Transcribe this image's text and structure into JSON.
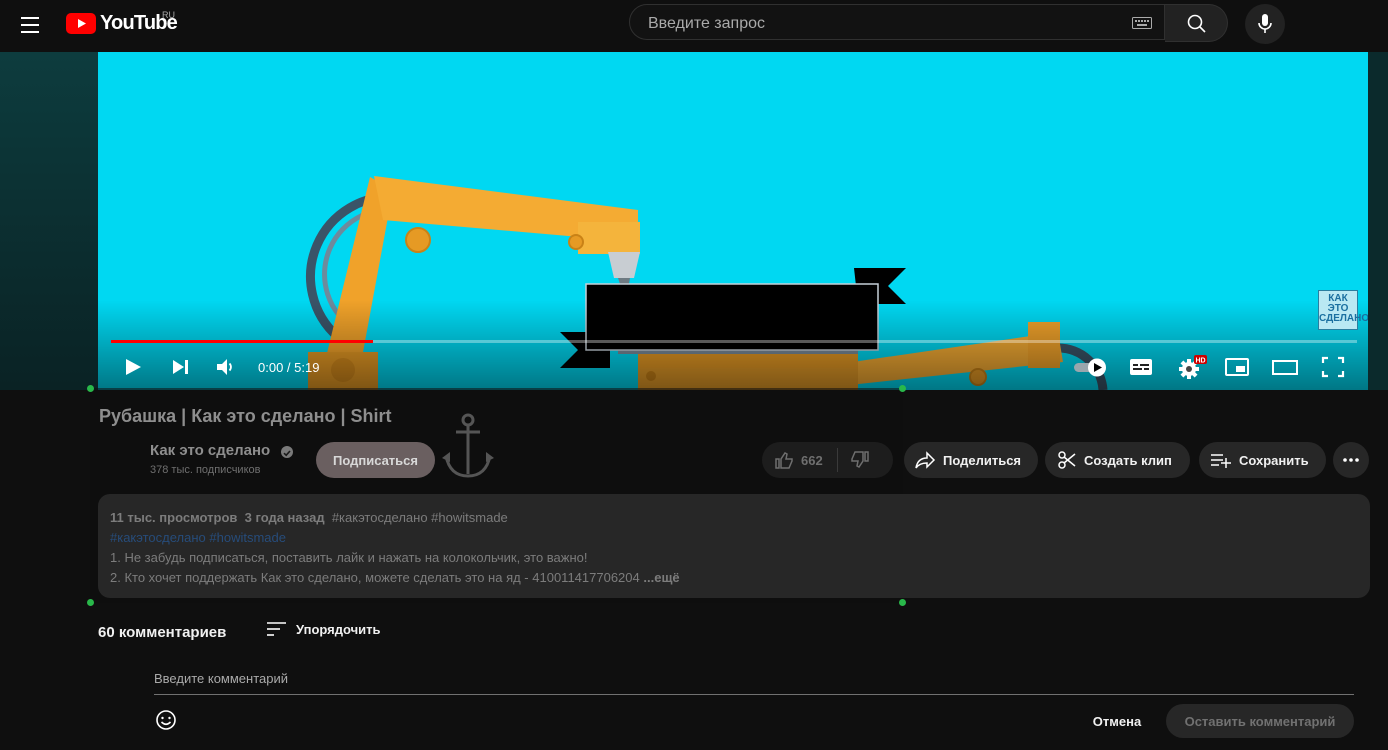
{
  "header": {
    "logo_text": "YouTube",
    "region": "RU",
    "search_placeholder": "Введите запрос"
  },
  "player": {
    "time": "0:00 / 5:19",
    "progress": 0.21,
    "watermark": "КАК ЭТО СДЕЛАНО",
    "hd_badge": "HD"
  },
  "video": {
    "title": "Рубашка | Как это сделано | Shirt",
    "channel": "Как это сделано",
    "subscribers": "378 тыс. подписчиков",
    "subscribe_label": "Подписаться",
    "likes": "662"
  },
  "actions": {
    "share": "Поделиться",
    "clip": "Создать клип",
    "save": "Сохранить"
  },
  "description": {
    "views": "11 тыс. просмотров",
    "date": "3 года назад",
    "header_tags": "#какэтосделано #howitsmade",
    "tag1": "#какэтосделано",
    "tag2": "#howitsmade",
    "line1": "1. Не забудь подписаться, поставить лайк и нажать на колокольчик, это важно!",
    "line2": "2. Кто хочет поддержать Как это сделано, можете сделать это на яд - 410011417706204",
    "more": "...ещё"
  },
  "comments": {
    "count": "60 комментариев",
    "sort_label": "Упорядочить",
    "input_placeholder": "Введите комментарий",
    "cancel": "Отмена",
    "submit": "Оставить комментарий"
  },
  "colors": {
    "accent": "#ff0000",
    "video_bg": "#00dcf5",
    "robot_arm": "#f3a62c"
  },
  "icons": [
    "menu-icon",
    "youtube-logo-icon",
    "keyboard-icon",
    "search-icon",
    "mic-icon",
    "play-icon",
    "next-icon",
    "volume-icon",
    "autoplay-toggle-icon",
    "subtitles-icon",
    "settings-icon",
    "miniplayer-icon",
    "theater-icon",
    "fullscreen-icon",
    "verified-icon",
    "anchor-icon",
    "like-icon",
    "dislike-icon",
    "share-icon",
    "scissors-icon",
    "save-playlist-icon",
    "more-icon",
    "sort-icon",
    "emoji-icon"
  ]
}
